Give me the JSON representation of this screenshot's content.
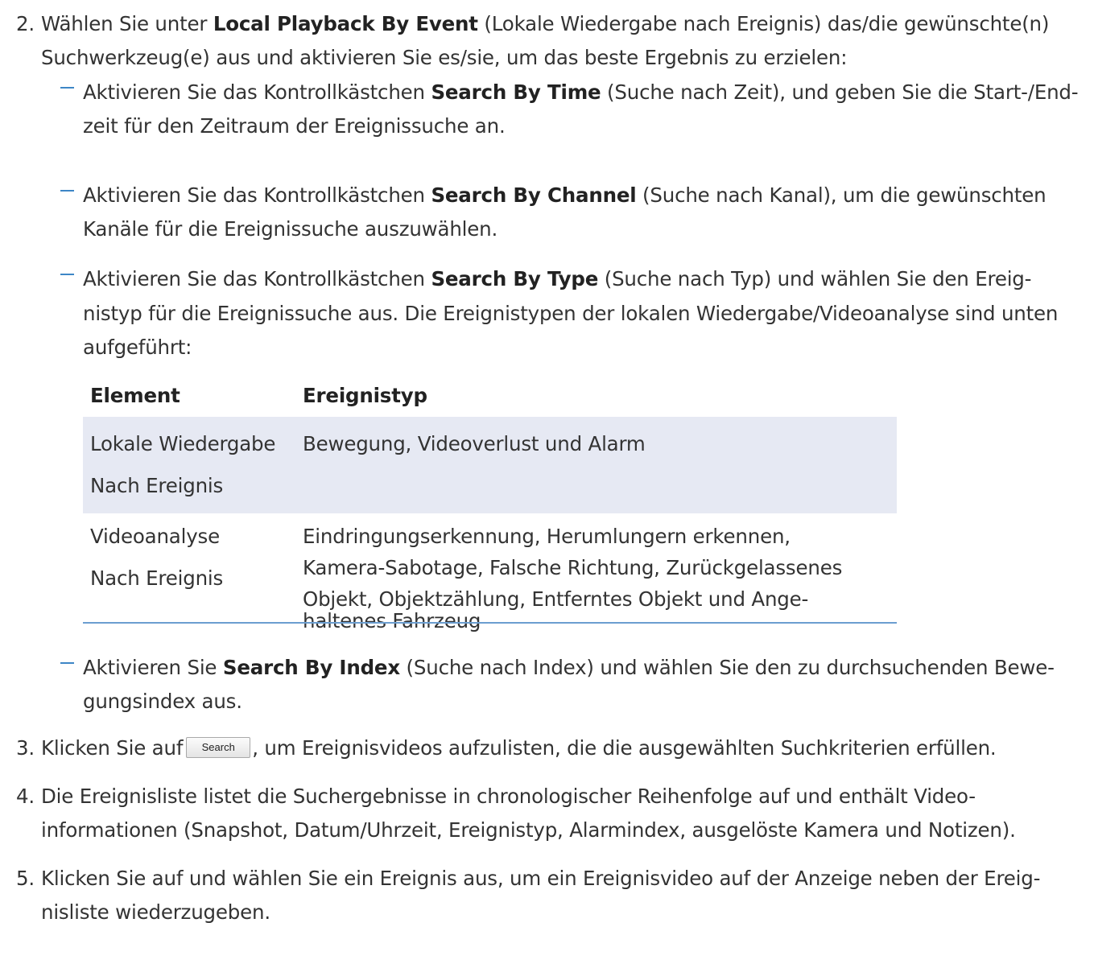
{
  "step2": {
    "num": "2.",
    "l1_a": "Wählen Sie unter ",
    "l1_b": "Local Playback By Event",
    "l1_c": " (Lokale Wiedergabe nach Ereignis) das/die gewünschte(n)",
    "l2": "Suchwerkzeug(e) aus und aktivieren Sie es/sie, um das beste Ergebnis zu erzielen:"
  },
  "bullet_time": {
    "l1_a": "Aktivieren Sie das Kontrollkästchen ",
    "l1_b": "Search By Time",
    "l1_c": " (Suche nach Zeit), und geben Sie die Start-/End-",
    "l2": "zeit für den Zeitraum der Ereignissuche an."
  },
  "bullet_channel": {
    "l1_a": "Aktivieren Sie das Kontrollkästchen ",
    "l1_b": "Search By Channel",
    "l1_c": " (Suche nach Kanal), um die gewünschten",
    "l2": "Kanäle für die Ereignissuche auszuwählen."
  },
  "bullet_type": {
    "l1_a": "Aktivieren Sie das Kontrollkästchen ",
    "l1_b": "Search By Type",
    "l1_c": " (Suche nach Typ) und wählen Sie den Ereig-",
    "l2": "nistyp für die Ereignissuche aus. Die Ereignistypen der lokalen Wiedergabe/Videoanalyse sind unten",
    "l3": "aufgeführt:"
  },
  "table": {
    "headers": [
      "Element",
      "Ereignistyp"
    ],
    "rows": [
      {
        "element": [
          "Lokale Wiedergabe",
          "Nach Ereignis"
        ],
        "types": [
          "Bewegung, Videoverlust und Alarm"
        ]
      },
      {
        "element": [
          "Videoanalyse",
          "Nach Ereignis"
        ],
        "types": [
          "Eindringungserkennung, Herumlungern erkennen,",
          "Kamera-Sabotage, Falsche Richtung, Zurückgelassenes",
          "Objekt, Objektzählung, Entferntes Objekt und Ange-",
          "haltenes Fahrzeug"
        ]
      }
    ],
    "shade_color": "#e6e9f3",
    "rule_color": "#6b9ed0"
  },
  "bullet_index": {
    "l1_a": "Aktivieren Sie ",
    "l1_b": "Search By Index",
    "l1_c": " (Suche nach Index) und wählen Sie den zu durchsuchenden Bewe-",
    "l2": "gungsindex aus."
  },
  "step3": {
    "num": "3.",
    "a": "Klicken Sie auf",
    "button": "Search",
    "b": ", um Ereignisvideos aufzulisten, die die ausgewählten Suchkriterien erfüllen."
  },
  "step4": {
    "num": "4.",
    "l1": "Die Ereignisliste listet die Suchergebnisse in chronologischer Reihenfolge auf und enthält Video-",
    "l2": "informationen (Snapshot, Datum/Uhrzeit, Ereignistyp, Alarmindex, ausgelöste Kamera und Notizen)."
  },
  "step5": {
    "num": "5.",
    "l1": "Klicken Sie auf und wählen Sie ein Ereignis aus, um ein Ereignisvideo auf der Anzeige neben der Ereig-",
    "l2": "nisliste wiederzugeben."
  },
  "accent_color": "#3d86c6"
}
